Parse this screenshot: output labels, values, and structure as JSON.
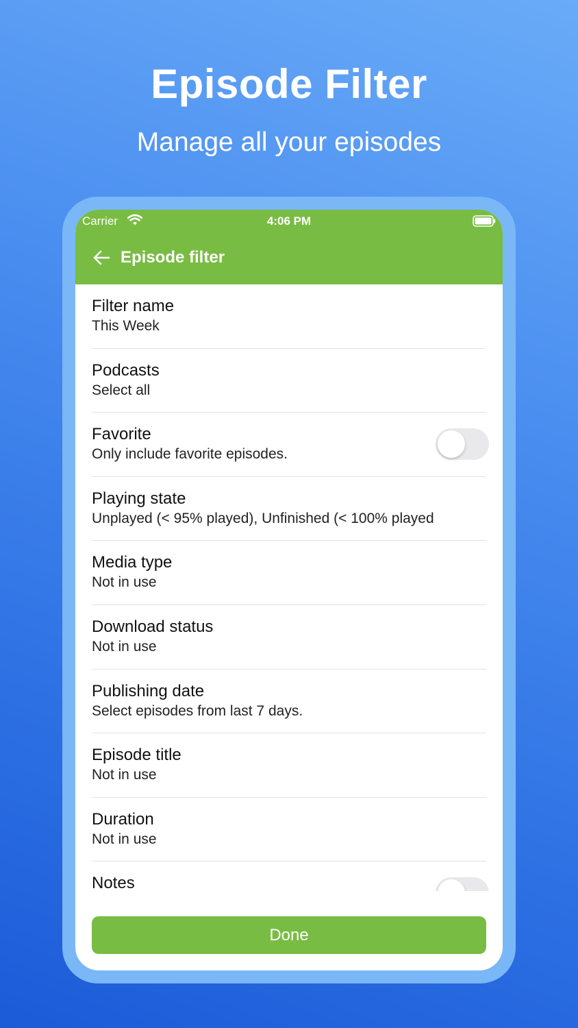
{
  "promo": {
    "title": "Episode Filter",
    "subtitle": "Manage all your episodes"
  },
  "status_bar": {
    "carrier": "Carrier",
    "time": "4:06 PM"
  },
  "header": {
    "title": "Episode filter",
    "back_icon": "arrow-left-icon"
  },
  "colors": {
    "accent": "#79bc43",
    "background_top": "#6aabf7",
    "background_bottom": "#1c5bd8"
  },
  "rows": [
    {
      "title": "Filter name",
      "subtitle": "This Week"
    },
    {
      "title": "Podcasts",
      "subtitle": "Select all"
    },
    {
      "title": "Favorite",
      "subtitle": "Only include favorite episodes.",
      "toggle": false
    },
    {
      "title": "Playing state",
      "subtitle": "Unplayed (< 95% played), Unfinished (< 100% played"
    },
    {
      "title": "Media type",
      "subtitle": "Not in use"
    },
    {
      "title": "Download status",
      "subtitle": "Not in use"
    },
    {
      "title": "Publishing date",
      "subtitle": "Select episodes from last 7 days."
    },
    {
      "title": "Episode title",
      "subtitle": "Not in use"
    },
    {
      "title": "Duration",
      "subtitle": "Not in use"
    },
    {
      "title": "Notes",
      "subtitle": "",
      "toggle": false
    }
  ],
  "done_button": {
    "label": "Done"
  }
}
